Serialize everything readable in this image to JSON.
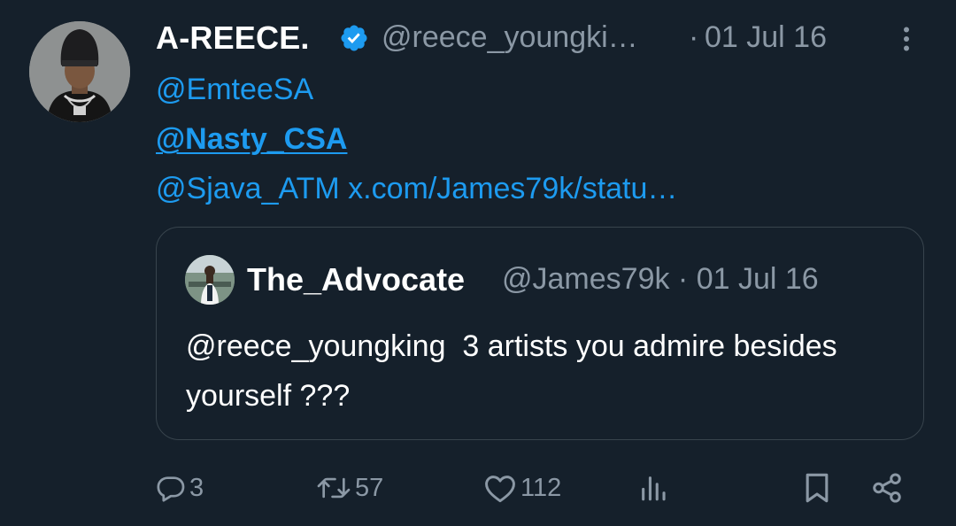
{
  "tweet": {
    "author": {
      "display_name": "A-REECE.",
      "verified": true,
      "handle": "@reece_youngki…",
      "separator": "·",
      "timestamp": "01 Jul 16"
    },
    "mentions": [
      "@EmteeSA",
      "@Nasty_CSA",
      "@Sjava_ATM"
    ],
    "link": "x.com/James79k/statu…",
    "quoted": {
      "display_name": "The_Advocate",
      "handle_time": "@James79k · 01 Jul 16",
      "text": "@reece_youngking  3 artists you admire besides yourself ???"
    },
    "actions": {
      "replies": "3",
      "retweets": "57",
      "likes": "112"
    }
  },
  "icons": {
    "verified": "verified-badge-icon",
    "more": "more-vertical-icon",
    "reply": "reply-icon",
    "retweet": "retweet-icon",
    "like": "heart-icon",
    "views": "views-icon",
    "bookmark": "bookmark-icon",
    "share": "share-icon"
  },
  "colors": {
    "background": "#15202b",
    "accent": "#1d9bf0",
    "muted_text": "#8b98a5",
    "border": "#38444d",
    "text": "#ffffff"
  }
}
